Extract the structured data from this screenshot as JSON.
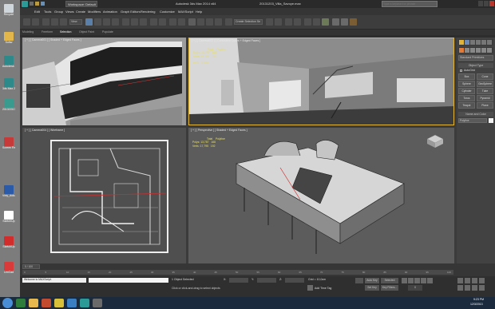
{
  "desktop": {
    "icons": [
      {
        "label": "Recycle"
      },
      {
        "label": "Softw"
      },
      {
        "label": "Autodesk 3"
      },
      {
        "label": "3ds Max 2"
      },
      {
        "label": "2013/2017"
      },
      {
        "label": "Screen Recorde"
      },
      {
        "label": "Vray_doku"
      },
      {
        "label": "SketchUp"
      },
      {
        "label": "SketchUp"
      },
      {
        "label": "LexCad"
      }
    ]
  },
  "titlebar": {
    "workspace_label": "Workspace: Default",
    "app_name": "Autodesk 3ds Max 2014 x64",
    "file_name": "20131203_Villa_Savoye.max",
    "search_placeholder": "Type a keyword or phrase"
  },
  "menu": {
    "items": [
      "Edit",
      "Tools",
      "Group",
      "Views",
      "Create",
      "Modifiers",
      "Animation",
      "Graph Editors",
      "Rendering",
      "Customize",
      "MAXScript",
      "Help"
    ]
  },
  "toolbar": {
    "view_dropdown": "View",
    "selection_set": "Create Selection Se"
  },
  "ribbon": {
    "tabs": [
      "Modeling",
      "Freeform",
      "Selection",
      "Object Paint",
      "Populate"
    ]
  },
  "viewports": {
    "top_left": {
      "label": "[ + ] [ Camera001 ] [ Shaded + Edged Faces ]"
    },
    "top_right": {
      "label": "[ + ] [ Camera002 ] [ Consistent Colors + Edged Faces ]",
      "stats": {
        "header_total": "Total",
        "header_sel": "Polyline",
        "polys_label": "Polys:",
        "polys_total": "13,787",
        "polys_sel": "168",
        "verts_label": "Verts:",
        "verts_total": "17,795",
        "verts_sel": "192",
        "fps_label": "FPS:",
        "fps_value": "9.378"
      }
    },
    "bottom_left": {
      "label": "[ + ] [ Camera004 ] [ Wireframe ]"
    },
    "bottom_right": {
      "label": "[ + ] [ Perspective ] [ Shaded + Edged Faces ]",
      "stats": {
        "header_total": "Total",
        "header_sel": "Polyline",
        "polys_label": "Polys:",
        "polys_total": "13,787",
        "polys_sel": "168",
        "verts_label": "Verts:",
        "verts_total": "17,795",
        "verts_sel": "192"
      }
    }
  },
  "command_panel": {
    "dropdown": "Standard Primitives",
    "rollout_object_type": "Object Type",
    "autogrid": "AutoGrid",
    "buttons": [
      "Box",
      "Cone",
      "Sphere",
      "GeoSphere",
      "Cylinder",
      "Tube",
      "Torus",
      "Pyramid",
      "Teapot",
      "Plane"
    ],
    "rollout_name_color": "Name and Color",
    "name_value": "Polyline",
    "accent_color": "#e6b838"
  },
  "timeline": {
    "frame_counter": "0 / 100",
    "ticks": [
      "0",
      "5",
      "10",
      "15",
      "20",
      "25",
      "30",
      "35",
      "40",
      "45",
      "50",
      "55",
      "60",
      "65",
      "70",
      "75",
      "80",
      "85",
      "90",
      "95",
      "100"
    ]
  },
  "status": {
    "listener": "Welcome to MAXScript.",
    "selected": "1 Object Selected",
    "prompt": "Click or click-and-drag to select objects",
    "x_label": "X:",
    "y_label": "Y:",
    "z_label": "Z:",
    "grid": "Grid = 10,0cm",
    "autokey": "Auto Key",
    "selected_dd": "Selected",
    "setkey": "Set Key",
    "keyfilters": "Key Filters...",
    "add_time_tag": "Add Time Tag",
    "frame": "0"
  },
  "taskbar": {
    "time": "9:23 PM",
    "date": "12/3/2013"
  }
}
